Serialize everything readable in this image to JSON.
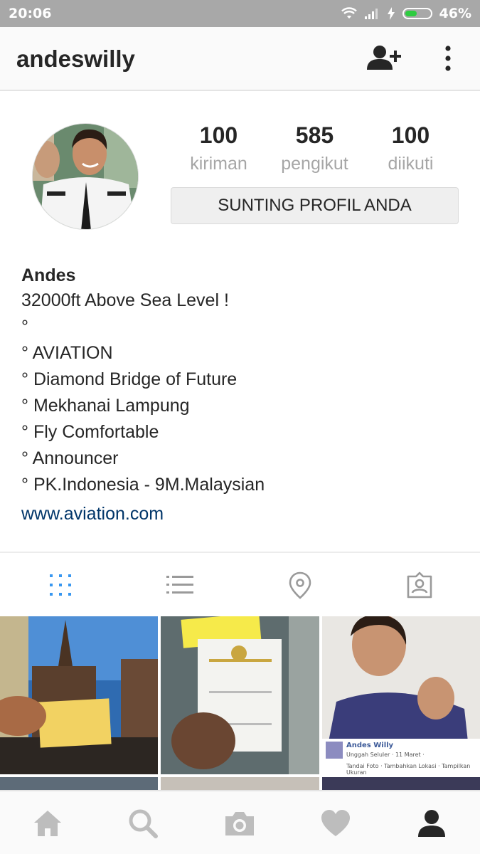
{
  "status_bar": {
    "time": "20:06",
    "battery": "46%"
  },
  "header": {
    "username": "andeswilly",
    "icons": [
      "add-user-icon",
      "more-vertical-icon"
    ]
  },
  "profile": {
    "stats": [
      {
        "value": "100",
        "label": "kiriman"
      },
      {
        "value": "585",
        "label": "pengikut"
      },
      {
        "value": "100",
        "label": "diikuti"
      }
    ],
    "edit_button": "SUNTING PROFIL ANDA",
    "name": "Andes",
    "bio_lines": [
      "32000ft Above Sea Level !",
      "°",
      "° AVIATION",
      "° Diamond Bridge of Future",
      "° Mekhanai Lampung",
      "° Fly Comfortable",
      "° Announcer",
      "° PK.Indonesia - 9M.Malaysian"
    ],
    "website": "www.aviation.com"
  },
  "view_tabs": [
    "grid-icon",
    "list-icon",
    "location-pin-icon",
    "tagged-icon"
  ],
  "posts": {
    "third_tile": {
      "name": "Andes Willy",
      "meta": "Unggah Seluler · 11 Maret ·",
      "actions": "Tandai Foto · Tambahkan Lokasi · Tampilkan Ukuran"
    }
  },
  "bottom_nav": [
    "home-icon",
    "search-icon",
    "camera-icon",
    "heart-icon",
    "profile-icon"
  ],
  "colors": {
    "accent": "#3897f0",
    "link": "#003569",
    "status_bar": "#a8a8a8"
  }
}
